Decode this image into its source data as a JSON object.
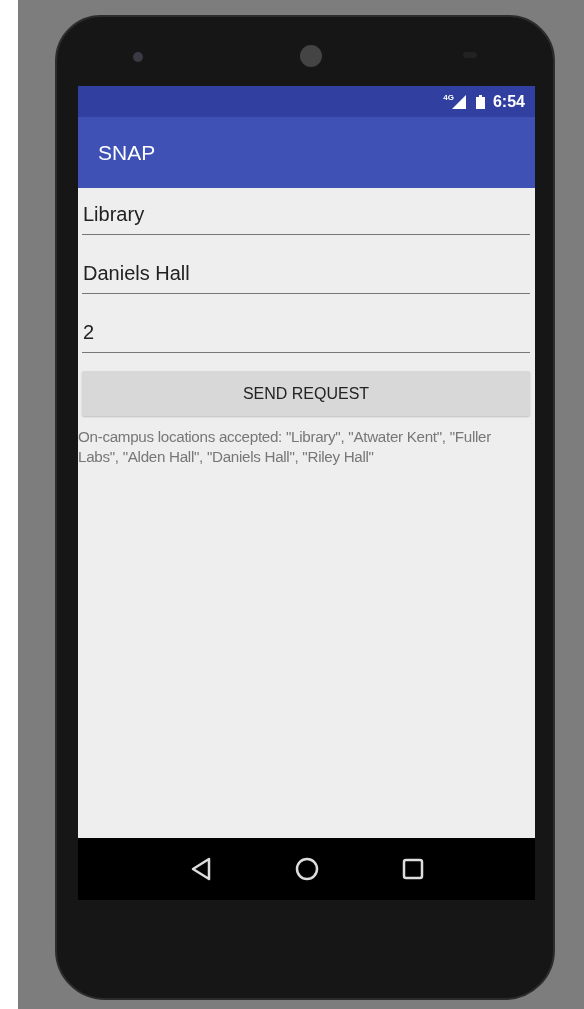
{
  "status_bar": {
    "network": "4G",
    "time": "6:54"
  },
  "app_bar": {
    "title": "SNAP"
  },
  "fields": [
    {
      "value": "Library"
    },
    {
      "value": "Daniels Hall"
    },
    {
      "value": "2"
    }
  ],
  "button": {
    "label": "SEND REQUEST"
  },
  "note": "On-campus locations accepted: \"Library\", \"Atwater Kent\", \"Fuller Labs\", \"Alden Hall\", \"Daniels Hall\", \"Riley Hall\""
}
